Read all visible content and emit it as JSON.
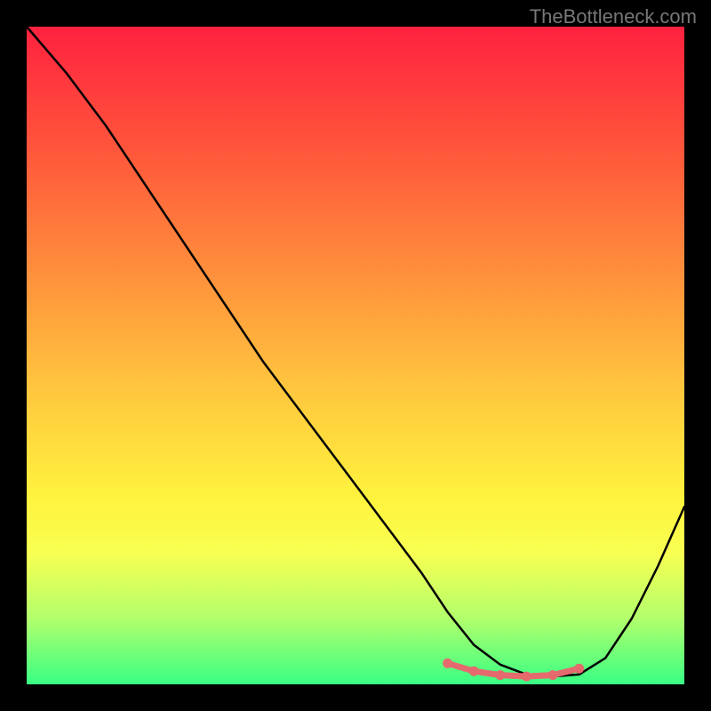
{
  "watermark": "TheBottleneck.com",
  "chart_data": {
    "type": "line",
    "title": "",
    "xlabel": "",
    "ylabel": "",
    "xlim": [
      0,
      100
    ],
    "ylim": [
      0,
      100
    ],
    "grid": false,
    "legend": false,
    "series": [
      {
        "name": "curve",
        "color": "#000000",
        "x": [
          0,
          6,
          12,
          18,
          24,
          30,
          36,
          42,
          48,
          54,
          60,
          64,
          68,
          72,
          76,
          80,
          84,
          88,
          92,
          96,
          100
        ],
        "y": [
          100,
          93,
          85,
          76,
          67,
          58,
          49,
          41,
          33,
          25,
          17,
          11,
          6,
          3,
          1.5,
          1.2,
          1.5,
          4,
          10,
          18,
          27
        ]
      },
      {
        "name": "highlight",
        "color": "#e56a6e",
        "type": "scatter-line",
        "x": [
          64,
          68,
          72,
          76,
          80,
          84
        ],
        "y": [
          3.2,
          2.0,
          1.4,
          1.2,
          1.4,
          2.4
        ]
      }
    ]
  }
}
